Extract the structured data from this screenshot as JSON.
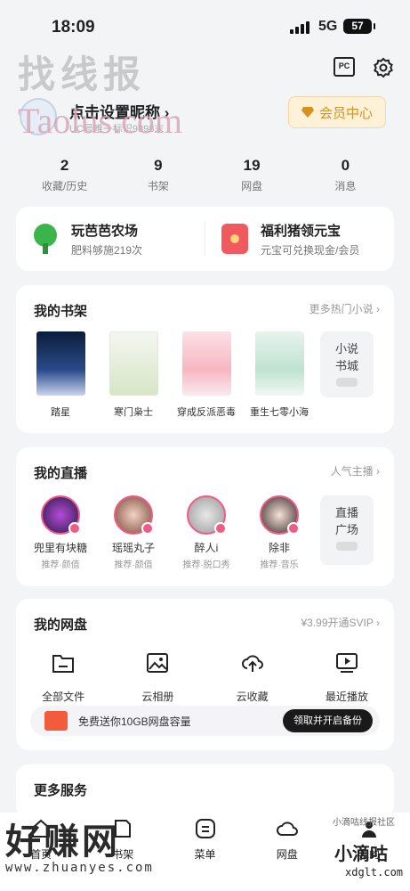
{
  "status_bar": {
    "time": "18:09",
    "network": "5G",
    "battery": "57"
  },
  "watermarks": {
    "top": "找线报",
    "url": "Taolus.com",
    "bottom_left": "好赚网",
    "bottom_left_url": "www.zhuanyes.com",
    "bottom_right_top": "小滴咕线报社区",
    "bottom_right_mid": "小滴咕",
    "bottom_right_url": "xdglt.com"
  },
  "header": {
    "pc_label": "PC"
  },
  "profile": {
    "nickname": "点击设置昵称 ›",
    "uid": "UC号唯一标识9898末",
    "vip_label": "会员中心"
  },
  "stats": [
    {
      "num": "2",
      "label": "收藏/历史"
    },
    {
      "num": "9",
      "label": "书架"
    },
    {
      "num": "19",
      "label": "网盘"
    },
    {
      "num": "0",
      "label": "消息"
    }
  ],
  "promo": [
    {
      "title": "玩芭芭农场",
      "sub": "肥料够施219次"
    },
    {
      "title": "福利猪领元宝",
      "sub": "元宝可兑换现金/会员"
    }
  ],
  "bookshelf": {
    "title": "我的书架",
    "more": "更多热门小说 ›",
    "books": [
      "踏星",
      "寒门枭士",
      "穿成反派恶毒",
      "重生七零小海"
    ],
    "more_box": [
      "小说",
      "书城"
    ]
  },
  "live": {
    "title": "我的直播",
    "more": "人气主播 ›",
    "hosts": [
      {
        "name": "兜里有块糖",
        "tag": "推荐·颜值"
      },
      {
        "name": "瑶瑶丸子",
        "tag": "推荐·颜值"
      },
      {
        "name": "醉人i",
        "tag": "推荐·脱口秀"
      },
      {
        "name": "除非",
        "tag": "推荐·音乐"
      }
    ],
    "more_box": [
      "直播",
      "广场"
    ]
  },
  "disk": {
    "title": "我的网盘",
    "more": "¥3.99开通SVIP ›",
    "items": [
      "全部文件",
      "云相册",
      "云收藏",
      "最近播放"
    ],
    "gift_text": "免费送你10GB网盘容量",
    "gift_button": "领取并开启备份"
  },
  "services": {
    "title": "更多服务"
  },
  "tabbar": [
    "首页",
    "书架",
    "菜单",
    "网盘",
    "我的"
  ],
  "colors": {
    "accent": "#f05b86",
    "vip": "#d89021"
  }
}
